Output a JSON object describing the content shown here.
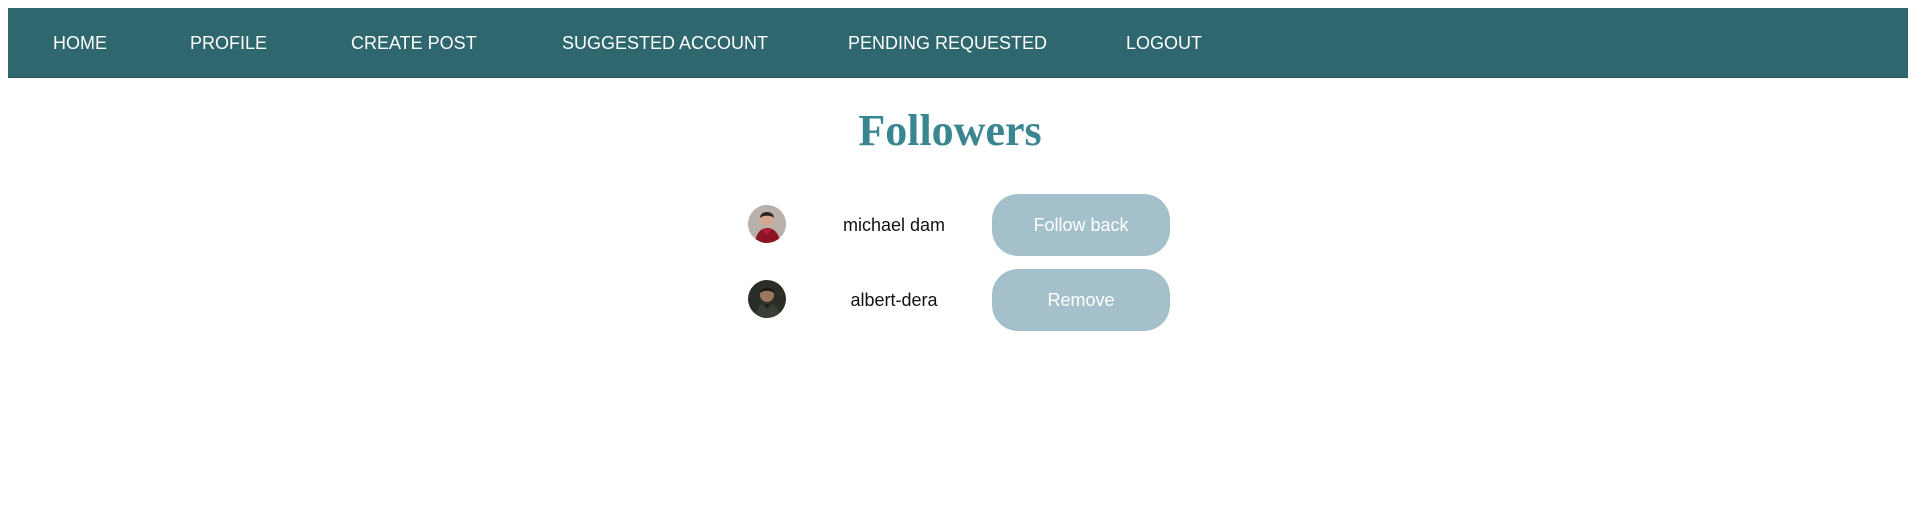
{
  "nav": {
    "home": "HOME",
    "profile": "PROFILE",
    "create_post": "CREATE POST",
    "suggested_account": "SUGGESTED ACCOUNT",
    "pending_requested": "PENDING REQUESTED",
    "logout": "LOGOUT"
  },
  "page": {
    "title": "Followers"
  },
  "followers": [
    {
      "username": "michael dam",
      "action_label": "Follow back",
      "avatar_icon": "person-avatar-red-shirt"
    },
    {
      "username": "albert-dera",
      "action_label": "Remove",
      "avatar_icon": "person-avatar-dark"
    }
  ],
  "colors": {
    "navbar": "#2e676d",
    "title": "#3a8690",
    "button": "#a4c0ca",
    "button_text": "#ffffff"
  }
}
